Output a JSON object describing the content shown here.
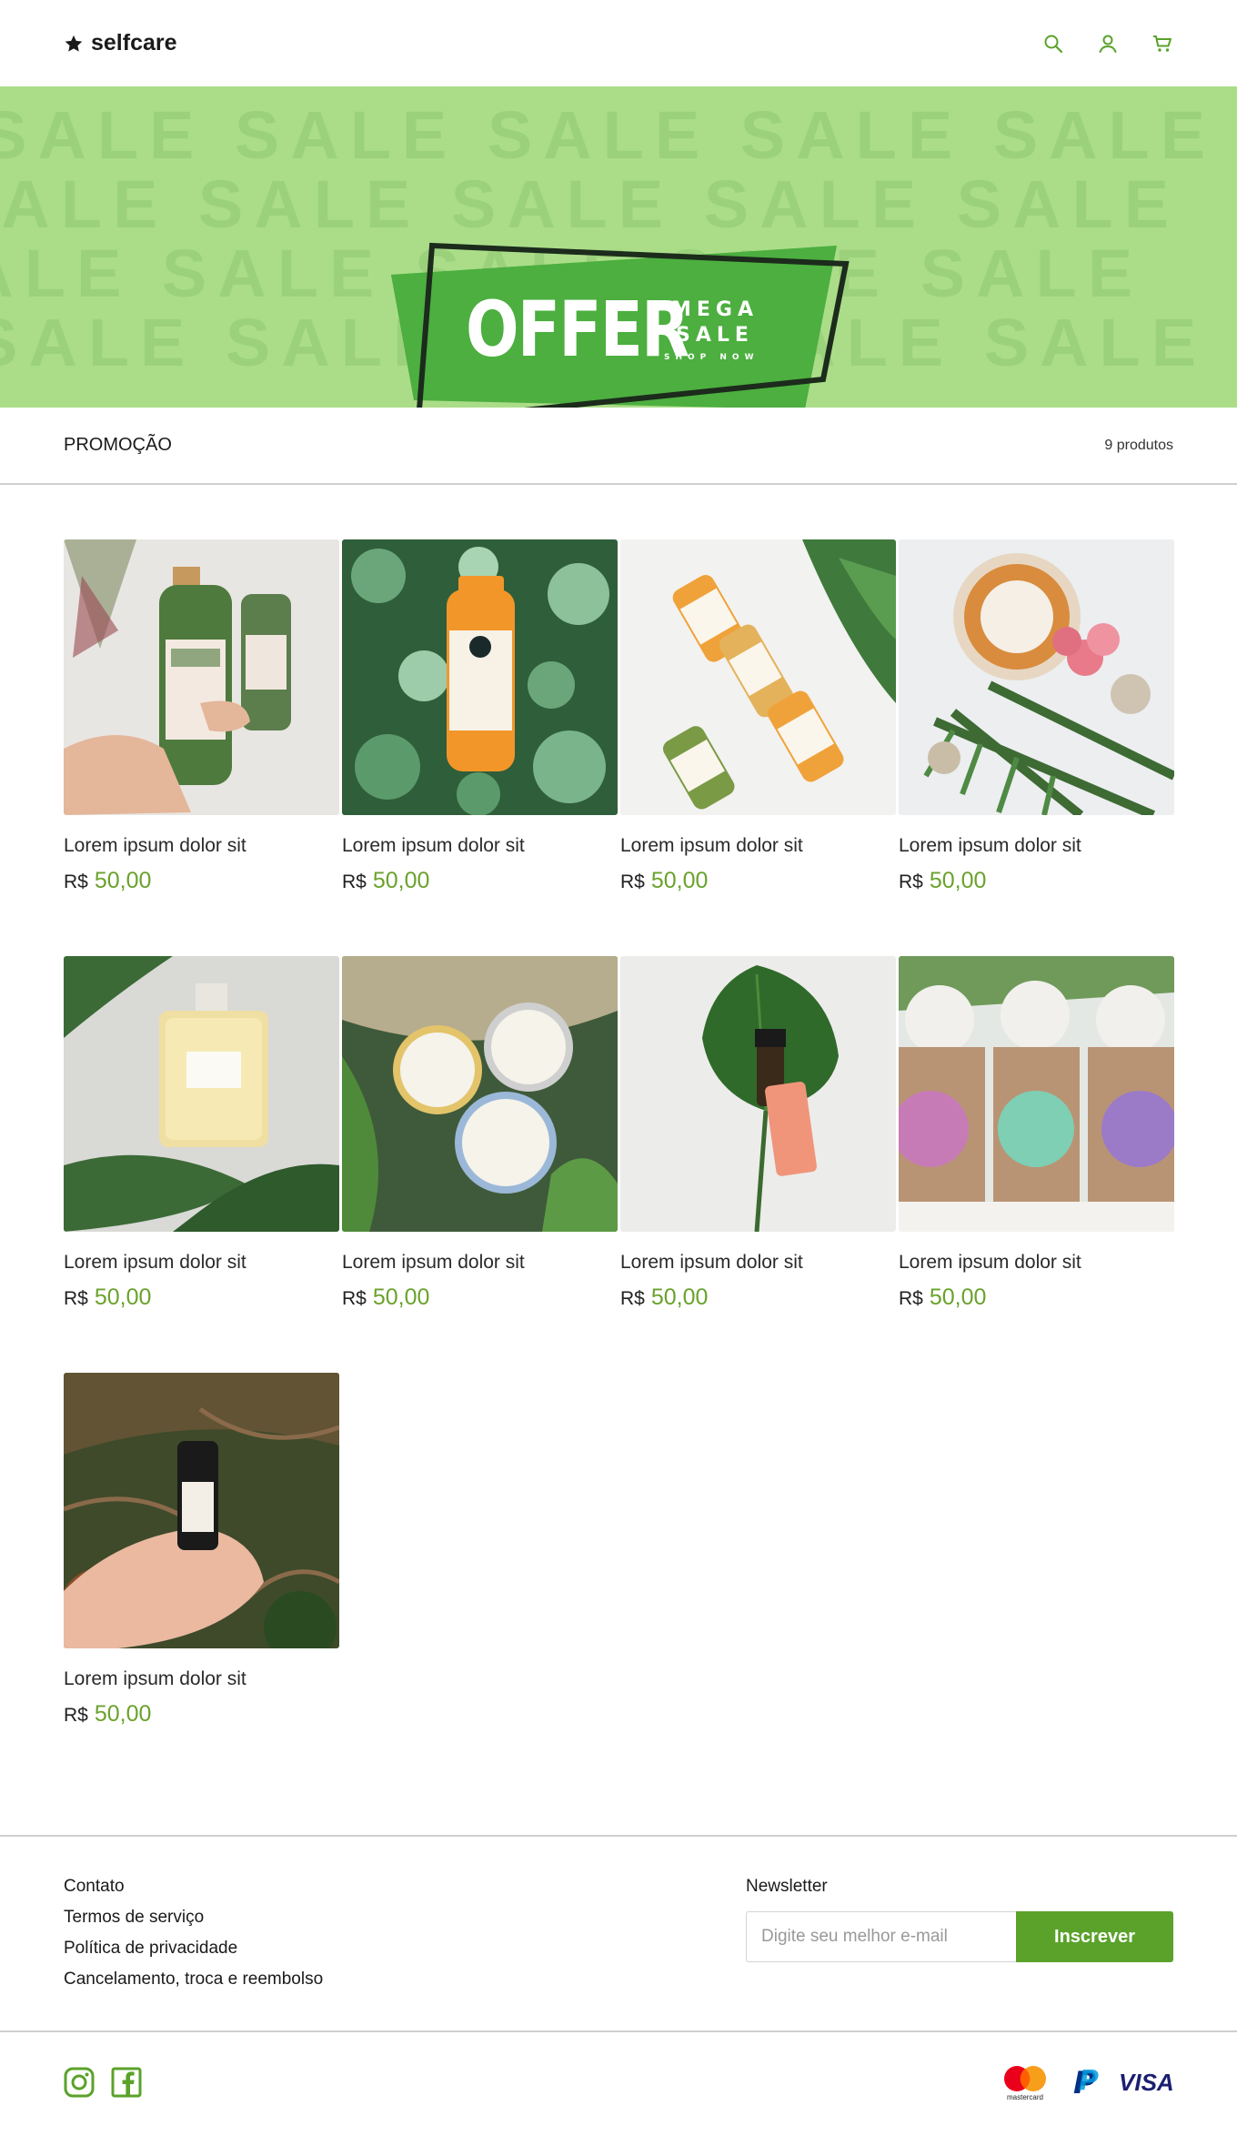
{
  "brand": {
    "name": "selfcare",
    "logo_icon": "star-icon",
    "accent": "#6aa22c"
  },
  "header": {
    "icons": [
      "search-icon",
      "user-icon",
      "cart-icon"
    ]
  },
  "banner": {
    "background": "#abdd89",
    "pattern_word": "SALE",
    "offer": "OFFER",
    "mega": "MEGA",
    "sale": "SALE",
    "shop_now": "SHOP NOW"
  },
  "collection": {
    "title": "PROMOÇÃO",
    "count": "9 produtos"
  },
  "products": [
    {
      "name": "Lorem ipsum dolor sit",
      "currency": "R$",
      "price": "50,00"
    },
    {
      "name": "Lorem ipsum dolor sit",
      "currency": "R$",
      "price": "50,00"
    },
    {
      "name": "Lorem ipsum dolor sit",
      "currency": "R$",
      "price": "50,00"
    },
    {
      "name": "Lorem ipsum dolor sit",
      "currency": "R$",
      "price": "50,00"
    },
    {
      "name": "Lorem ipsum dolor sit",
      "currency": "R$",
      "price": "50,00"
    },
    {
      "name": "Lorem ipsum dolor sit",
      "currency": "R$",
      "price": "50,00"
    },
    {
      "name": "Lorem ipsum dolor sit",
      "currency": "R$",
      "price": "50,00"
    },
    {
      "name": "Lorem ipsum dolor sit",
      "currency": "R$",
      "price": "50,00"
    },
    {
      "name": "Lorem ipsum dolor sit",
      "currency": "R$",
      "price": "50,00"
    }
  ],
  "footer": {
    "links": [
      "Contato",
      "Termos de serviço",
      "Política de privacidade",
      "Cancelamento, troca e reembolso"
    ],
    "newsletter": {
      "title": "Newsletter",
      "placeholder": "Digite seu melhor e-mail",
      "button": "Inscrever"
    },
    "social": [
      "instagram-icon",
      "facebook-icon"
    ],
    "payments": {
      "mastercard": "mastercard",
      "paypal": "P",
      "visa": "VISA"
    }
  }
}
